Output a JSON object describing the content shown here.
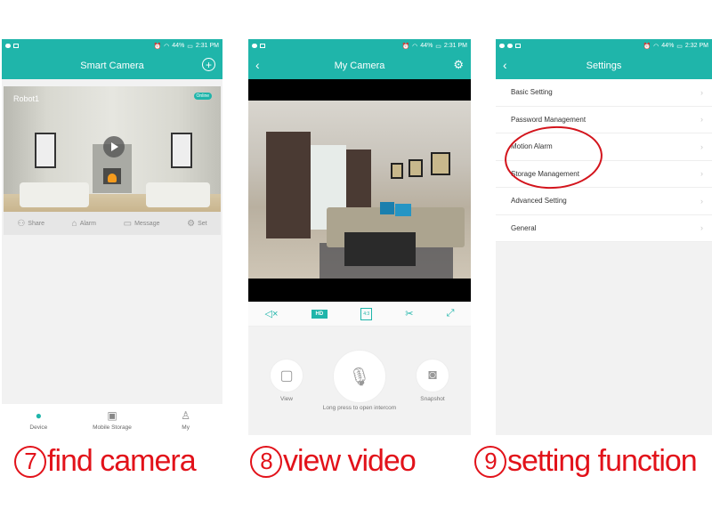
{
  "status_bar": {
    "signal": "44%",
    "time_1": "2:31 PM",
    "time_2": "2:31 PM",
    "time_3": "2:32 PM"
  },
  "screen_find_camera": {
    "title": "Smart Camera",
    "add_icon": "plus-circle-icon",
    "camera": {
      "name": "Robot1",
      "status": "Online"
    },
    "actions": [
      {
        "icon": "share-icon",
        "label": "Share"
      },
      {
        "icon": "home-icon",
        "label": "Alarm"
      },
      {
        "icon": "message-icon",
        "label": "Message"
      },
      {
        "icon": "gear-icon",
        "label": "Set"
      }
    ],
    "tabs": [
      {
        "icon": "camera-pin-icon",
        "label": "Device",
        "active": true
      },
      {
        "icon": "image-icon",
        "label": "Mobile Storage",
        "active": false
      },
      {
        "icon": "person-icon",
        "label": "My",
        "active": false
      }
    ]
  },
  "screen_view_video": {
    "title": "My Camera",
    "controls": {
      "mute_icon": "speaker-mute-icon",
      "hd_label": "HD",
      "ratio_label": "4:3",
      "cut_icon": "scissors-icon",
      "fullscreen_icon": "expand-icon"
    },
    "view_label": "View",
    "intercom_label": "Long press to open intercom",
    "snapshot_label": "Snapshot"
  },
  "screen_settings": {
    "title": "Settings",
    "items": [
      "Basic Setting",
      "Password Management",
      "Motion Alarm",
      "Storage Management",
      "Advanced Setting",
      "General"
    ],
    "highlighted": [
      "Motion Alarm",
      "Storage Management"
    ]
  },
  "captions": [
    {
      "number": "7",
      "text": "find camera"
    },
    {
      "number": "8",
      "text": "view video"
    },
    {
      "number": "9",
      "text": "setting function"
    }
  ],
  "colors": {
    "accent": "#1fb5aa",
    "caption": "#e2121a"
  }
}
